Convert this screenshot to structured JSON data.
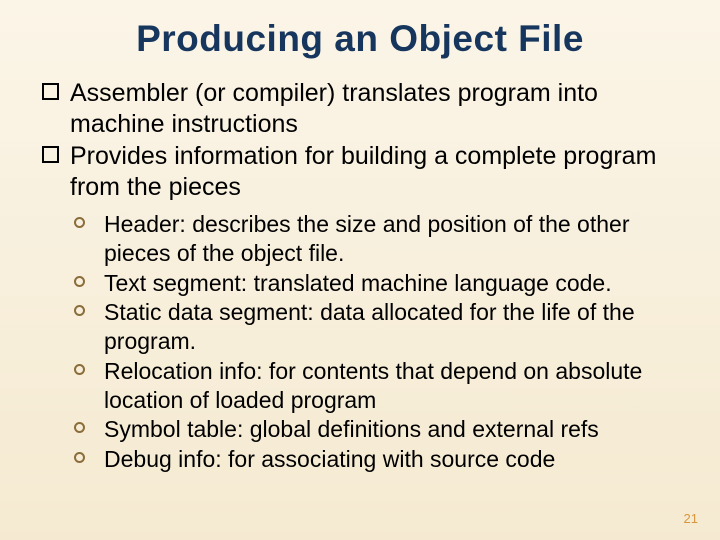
{
  "title": "Producing an Object File",
  "bullets": {
    "b1": "Assembler (or compiler) translates program into machine instructions",
    "b2": "Provides information for building a complete program from the pieces"
  },
  "subs": {
    "s1": "Header: describes the size and position of the other pieces of the object file.",
    "s2": "Text segment: translated machine language code.",
    "s3": "Static data segment: data allocated for the life of the program.",
    "s4": "Relocation info: for contents that depend on absolute location of loaded program",
    "s5": "Symbol table: global definitions and external refs",
    "s6": "Debug info: for associating with source code"
  },
  "page_number": "21"
}
